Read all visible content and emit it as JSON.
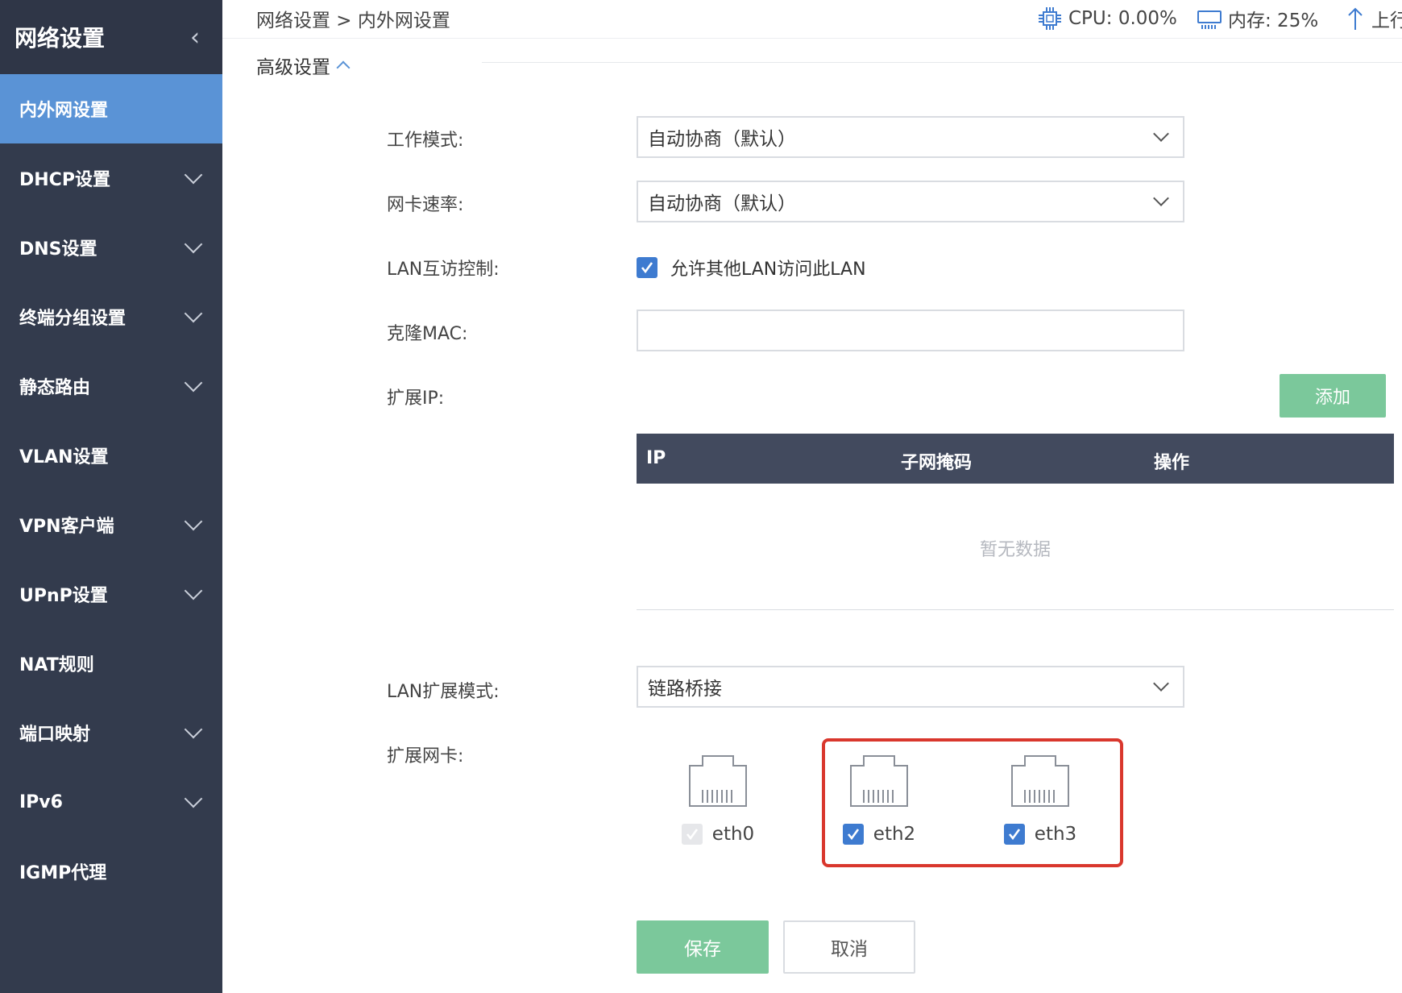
{
  "sidebar": {
    "title": "网络设置",
    "items": [
      {
        "label": "内外网设置",
        "active": true,
        "expandable": false
      },
      {
        "label": "DHCP设置",
        "expandable": true
      },
      {
        "label": "DNS设置",
        "expandable": true
      },
      {
        "label": "终端分组设置",
        "expandable": true
      },
      {
        "label": "静态路由",
        "expandable": true
      },
      {
        "label": "VLAN设置",
        "expandable": false
      },
      {
        "label": "VPN客户端",
        "expandable": true
      },
      {
        "label": "UPnP设置",
        "expandable": true
      },
      {
        "label": "NAT规则",
        "expandable": false
      },
      {
        "label": "端口映射",
        "expandable": true
      },
      {
        "label": "IPv6",
        "expandable": true
      },
      {
        "label": "IGMP代理",
        "expandable": false
      }
    ]
  },
  "header": {
    "breadcrumb": "网络设置 > 内外网设置",
    "cpu": "CPU: 0.00%",
    "memory": "内存: 25%",
    "upload": "上行"
  },
  "advanced": {
    "title": "高级设置"
  },
  "form": {
    "work_mode": {
      "label": "工作模式:",
      "value": "自动协商（默认）"
    },
    "nic_speed": {
      "label": "网卡速率:",
      "value": "自动协商（默认）"
    },
    "lan_access": {
      "label": "LAN互访控制:",
      "checkbox_label": "允许其他LAN访问此LAN",
      "checked": true
    },
    "clone_mac": {
      "label": "克隆MAC:",
      "value": ""
    },
    "ext_ip": {
      "label": "扩展IP:",
      "add_label": "添加"
    },
    "table": {
      "headers": [
        "IP",
        "子网掩码",
        "操作"
      ],
      "empty_text": "暂无数据"
    },
    "lan_ext_mode": {
      "label": "LAN扩展模式:",
      "value": "链路桥接"
    },
    "ext_nic": {
      "label": "扩展网卡:",
      "nics": [
        {
          "name": "eth0",
          "checked": true,
          "disabled": true
        },
        {
          "name": "eth2",
          "checked": true,
          "disabled": false
        },
        {
          "name": "eth3",
          "checked": true,
          "disabled": false
        }
      ]
    },
    "save_label": "保存",
    "cancel_label": "取消"
  },
  "colors": {
    "sidebar_bg": "#333b4d",
    "active_item": "#5a93d6",
    "primary_green": "#7bc89b",
    "table_head": "#424a5e",
    "checkbox": "#3e7bd0",
    "highlight": "#d9372d"
  }
}
